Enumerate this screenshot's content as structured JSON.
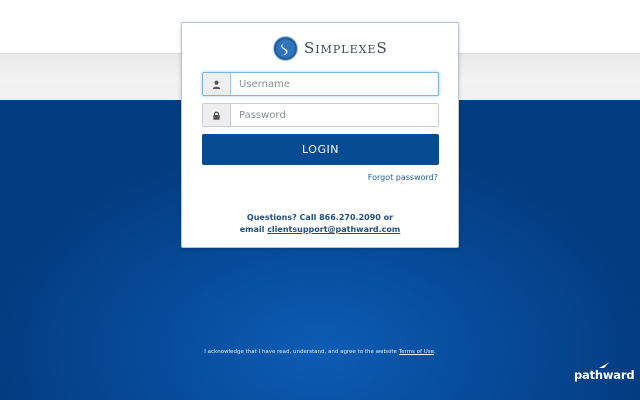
{
  "brand": {
    "name": "SimplexeS",
    "logo_icon": "simplexes-logo-icon",
    "colors": {
      "ring": "#1e5fa3",
      "ring_light": "#8fb4d9"
    }
  },
  "login": {
    "username_placeholder": "Username",
    "password_placeholder": "Password",
    "username_icon": "user-icon",
    "password_icon": "lock-icon",
    "button_label": "LOGIN",
    "forgot_password": "Forgot password?"
  },
  "support": {
    "line1": "Questions? Call 866.270.2090 or",
    "email_prefix": "email",
    "email": "clientsupport@pathward.com"
  },
  "footer": {
    "terms_text": "I acknowledge that I have read, understand, and agree to the website",
    "terms_link": "Terms of Use",
    "terms_suffix": ".",
    "logo_text": "pathward"
  },
  "colors": {
    "primary": "#074b92",
    "link": "#1f5fa5",
    "support_text": "#1f4e85",
    "background_blue": "#064a98"
  }
}
